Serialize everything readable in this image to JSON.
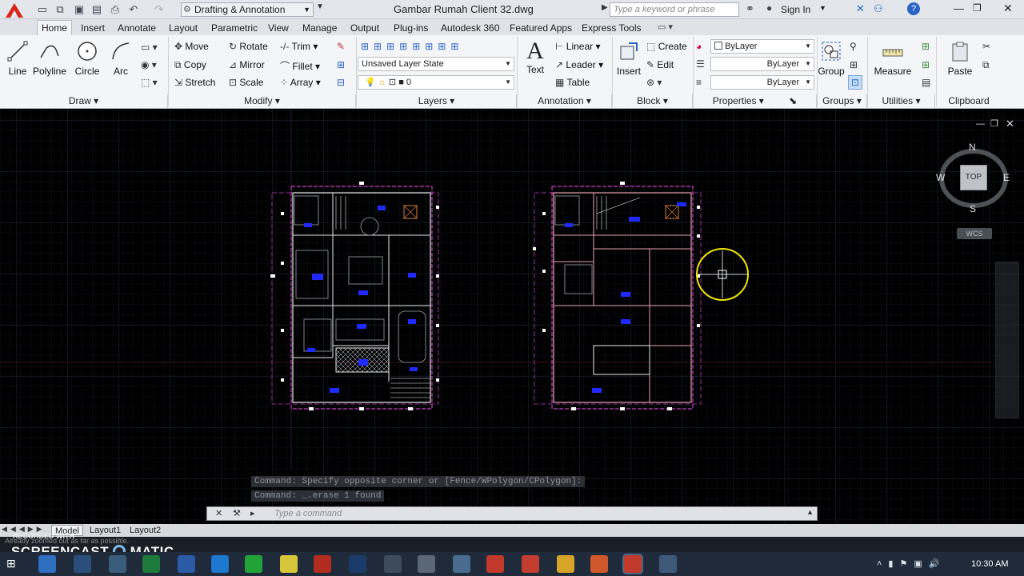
{
  "titlebar": {
    "workspace": "Drafting & Annotation",
    "filename": "Gambar Rumah Client 32.dwg",
    "search_placeholder": "Type a keyword or phrase",
    "sign_in": "Sign In"
  },
  "tabs": [
    "Home",
    "Insert",
    "Annotate",
    "Layout",
    "Parametric",
    "View",
    "Manage",
    "Output",
    "Plug-ins",
    "Autodesk 360",
    "Featured Apps",
    "Express Tools"
  ],
  "ribbon": {
    "draw": {
      "line": "Line",
      "polyline": "Polyline",
      "circle": "Circle",
      "arc": "Arc",
      "title": "Draw"
    },
    "modify": {
      "move": "Move",
      "rotate": "Rotate",
      "trim": "Trim",
      "copy": "Copy",
      "mirror": "Mirror",
      "fillet": "Fillet",
      "stretch": "Stretch",
      "scale": "Scale",
      "array": "Array",
      "title": "Modify"
    },
    "layers": {
      "layer_state": "Unsaved Layer State",
      "current_layer": "0",
      "title": "Layers"
    },
    "annotation": {
      "text": "Text",
      "linear": "Linear",
      "leader": "Leader",
      "table": "Table",
      "title": "Annotation"
    },
    "block": {
      "insert": "Insert",
      "create": "Create",
      "edit": "Edit",
      "title": "Block"
    },
    "properties": {
      "color": "ByLayer",
      "linetype": "ByLayer",
      "lineweight": "ByLayer",
      "title": "Properties"
    },
    "groups": {
      "group": "Group",
      "title": "Groups"
    },
    "utilities": {
      "measure": "Measure",
      "title": "Utilities"
    },
    "clipboard": {
      "paste": "Paste",
      "title": "Clipboard"
    }
  },
  "viewcube": {
    "n": "N",
    "s": "S",
    "e": "E",
    "w": "W",
    "face": "TOP",
    "wcs": "WCS"
  },
  "command": {
    "history_1": "Command: Specify opposite corner or [Fence/WPolygon/CPolygon]:",
    "history_2": "Command: _.erase 1 found",
    "placeholder": "Type a command"
  },
  "layout_tabs": [
    "Model",
    "Layout1",
    "Layout2"
  ],
  "watermark": {
    "recorded": "RECORDED WITH",
    "brand": "SCREENCAST",
    "brand2": "MATIC",
    "status": "Already zoomed out as far as possible."
  },
  "clock": "10:30 AM",
  "colors": {
    "accent": "#c0392b",
    "ribbon": "#f4f5f7",
    "canvas": "#000000",
    "plan_magenta": "#d43cd4",
    "plan_blue": "#1e2aff",
    "cursor_yellow": "#f2e600"
  }
}
